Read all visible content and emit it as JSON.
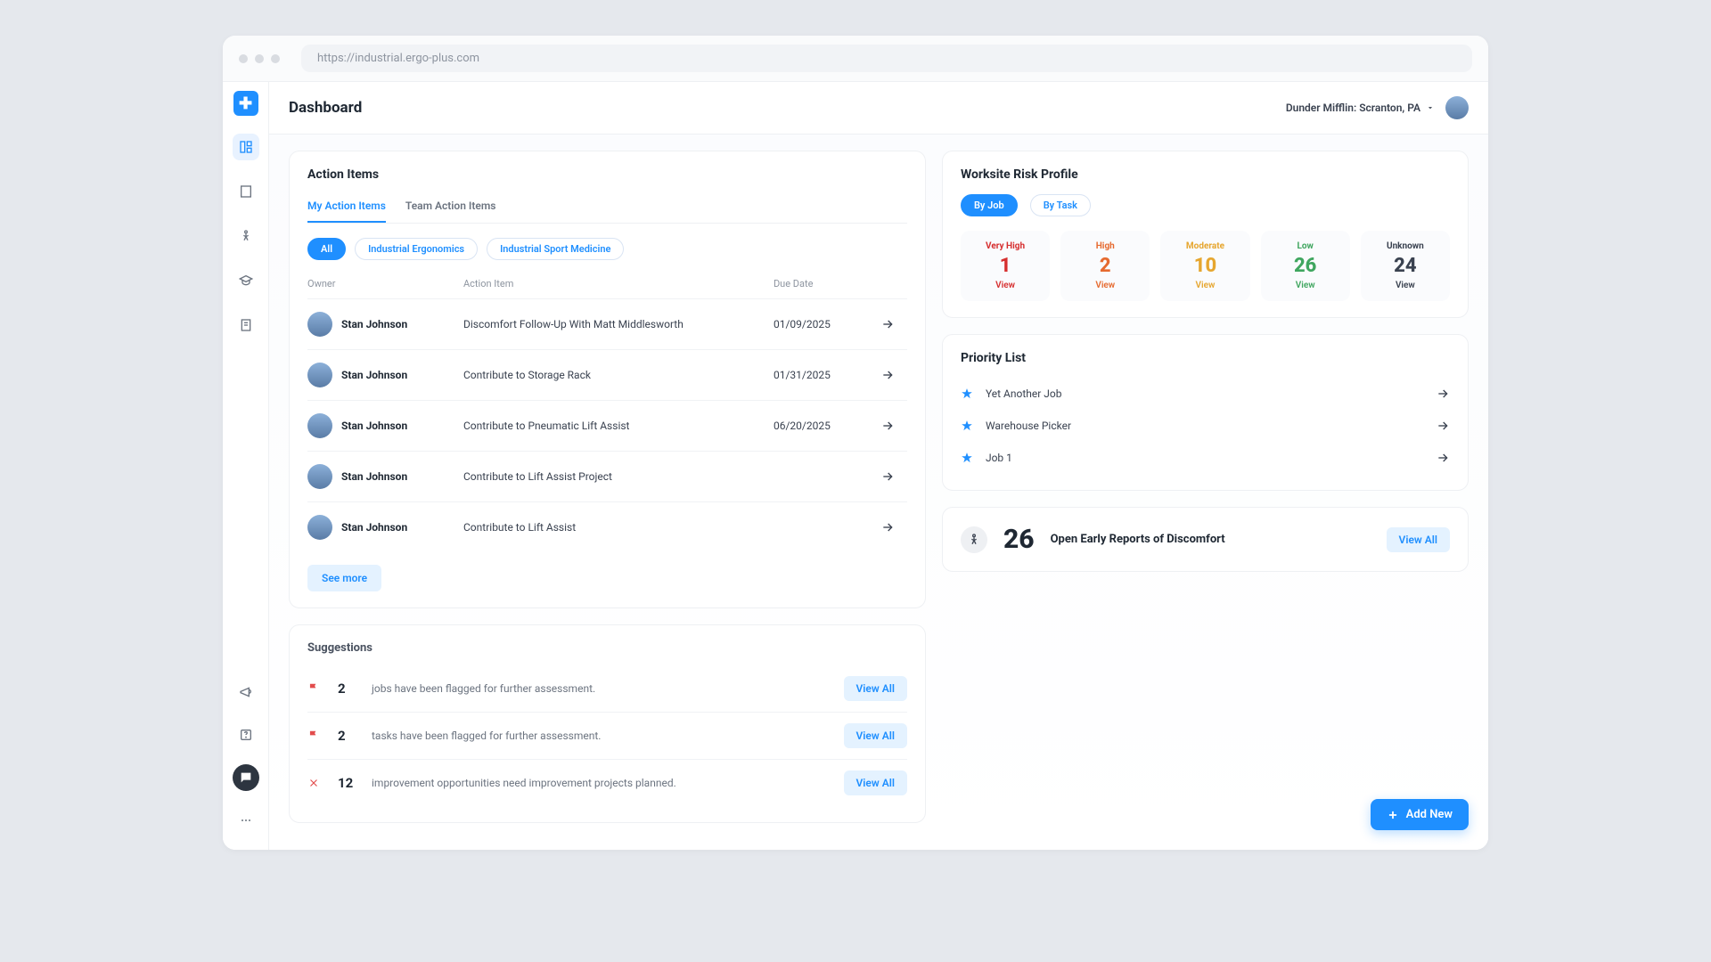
{
  "url": "https://industrial.ergo-plus.com",
  "page_title": "Dashboard",
  "location": "Dunder Mifflin: Scranton, PA",
  "action_items": {
    "title": "Action Items",
    "tabs": [
      "My Action Items",
      "Team Action Items"
    ],
    "filters": [
      "All",
      "Industrial Ergonomics",
      "Industrial Sport Medicine"
    ],
    "columns": {
      "owner": "Owner",
      "item": "Action Item",
      "due": "Due Date"
    },
    "rows": [
      {
        "owner": "Stan Johnson",
        "item": "Discomfort Follow-Up With Matt Middlesworth",
        "due": "01/09/2025"
      },
      {
        "owner": "Stan Johnson",
        "item": "Contribute to Storage Rack",
        "due": "01/31/2025"
      },
      {
        "owner": "Stan Johnson",
        "item": "Contribute to Pneumatic Lift Assist",
        "due": "06/20/2025"
      },
      {
        "owner": "Stan Johnson",
        "item": "Contribute to Lift Assist Project",
        "due": ""
      },
      {
        "owner": "Stan Johnson",
        "item": "Contribute to Lift Assist",
        "due": ""
      }
    ],
    "see_more": "See more"
  },
  "suggestions": {
    "title": "Suggestions",
    "items": [
      {
        "icon": "flag",
        "count": "2",
        "text": "jobs have been flagged for further assessment."
      },
      {
        "icon": "flag",
        "count": "2",
        "text": "tasks have been flagged for further assessment."
      },
      {
        "icon": "tools",
        "count": "12",
        "text": "improvement opportunities need improvement projects planned."
      }
    ],
    "view_all": "View All"
  },
  "risk": {
    "title": "Worksite Risk Profile",
    "tabs": [
      "By Job",
      "By Task"
    ],
    "levels": [
      {
        "label": "Very High",
        "value": "1",
        "cls": "vhigh"
      },
      {
        "label": "High",
        "value": "2",
        "cls": "high"
      },
      {
        "label": "Moderate",
        "value": "10",
        "cls": "mod"
      },
      {
        "label": "Low",
        "value": "26",
        "cls": "low"
      },
      {
        "label": "Unknown",
        "value": "24",
        "cls": "unk"
      }
    ],
    "view": "View"
  },
  "priority": {
    "title": "Priority List",
    "items": [
      "Yet Another Job",
      "Warehouse Picker",
      "Job 1"
    ]
  },
  "discomfort": {
    "count": "26",
    "label": "Open Early Reports of Discomfort",
    "view_all": "View All"
  },
  "add_new": "Add New"
}
